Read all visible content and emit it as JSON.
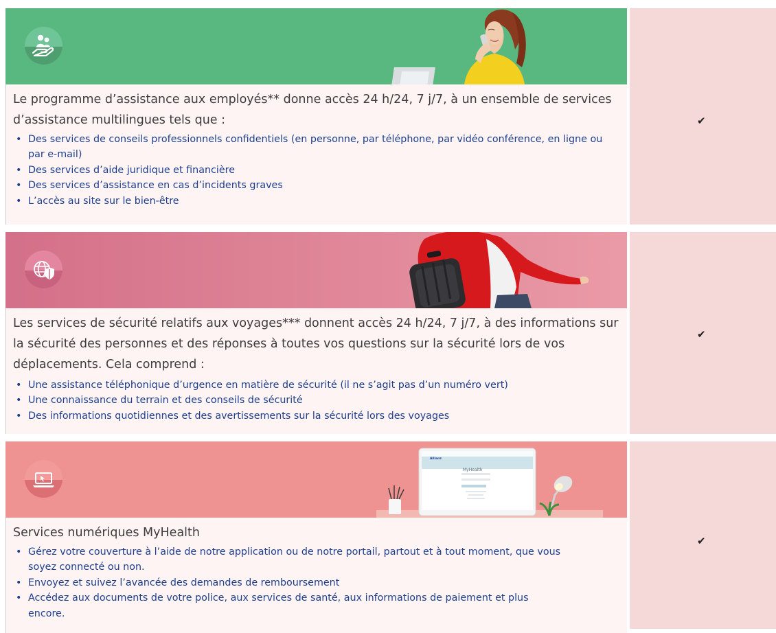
{
  "sections": [
    {
      "id": "employee-assistance",
      "icon": "hand-people-icon",
      "banner_color": "#5cbb82",
      "intro": "Le programme d’assistance aux employés** donne accès 24 h/24, 7 j/7, à un ensemble de services d’assistance multilingues tels que :",
      "bullets": [
        "Des services de conseils professionnels confidentiels (en personne, par téléphone, par vidéo conférence, en ligne ou par e-mail)",
        "Des services d’aide juridique et financière",
        "Des services d’assistance en cas d’incidents graves",
        "L’accès au site sur le bien-être"
      ],
      "check": "✔"
    },
    {
      "id": "travel-security",
      "icon": "globe-shield-icon",
      "banner_color": "#dd7d92",
      "intro": "Les services de sécurité relatifs aux voyages***  donnent accès 24 h/24, 7 j/7, à des informations sur la sécurité des personnes et des réponses à toutes vos questions sur la sécurité lors de vos déplacements. Cela comprend :",
      "bullets": [
        "Une assistance téléphonique d’urgence en matière de sécurité (il ne s’agit pas d’un numéro vert)",
        "Une connaissance du terrain et des conseils de sécurité",
        "Des informations quotidiennes et des avertissements sur la sécurité lors des voyages"
      ],
      "check": "✔"
    },
    {
      "id": "myhealth-digital",
      "icon": "laptop-cursor-icon",
      "banner_color": "#ec8d8f",
      "intro": "Services numériques MyHealth",
      "bullets": [
        "Gérez votre couverture à l’aide de notre application ou de notre portail, partout et à tout moment, que vous soyez connecté ou non.",
        "Envoyez et suivez l’avancée des demandes de remboursement",
        "Accédez aux documents de votre police, aux services de santé, aux informations de paiement et plus encore."
      ],
      "check": "✔",
      "screen": {
        "brand": "Allianz",
        "title": "MyHealth"
      }
    }
  ]
}
